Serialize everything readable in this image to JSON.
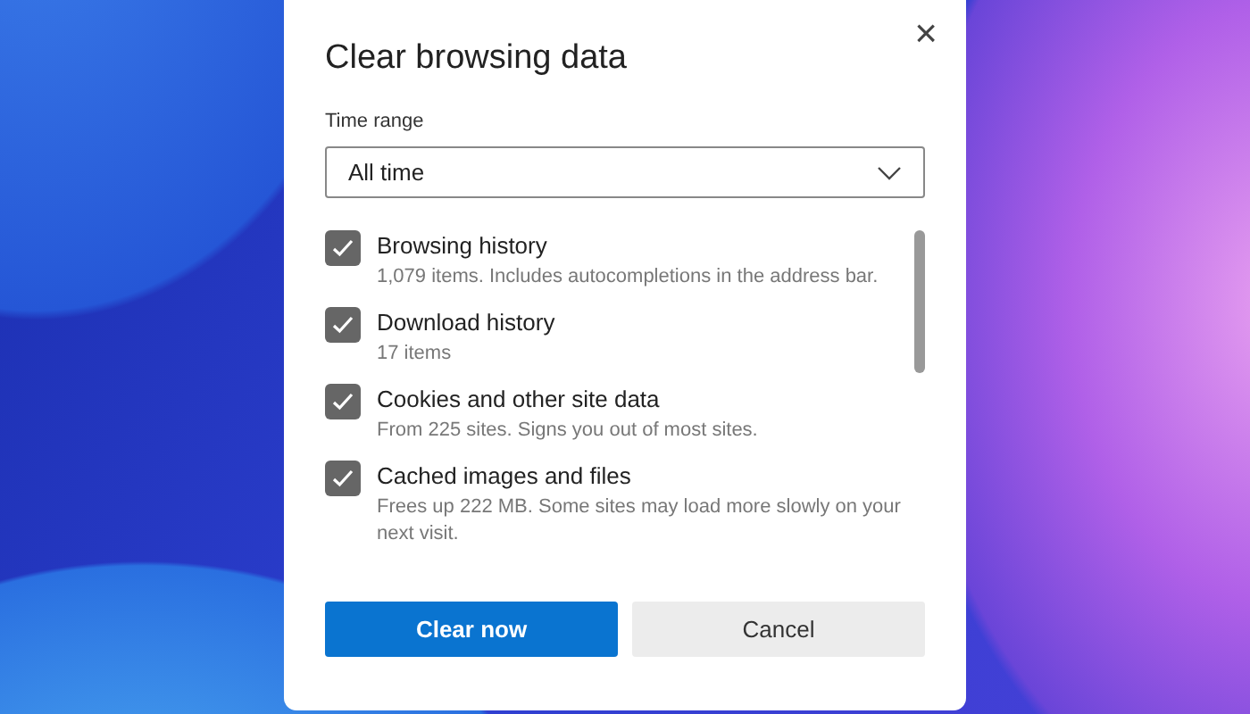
{
  "dialog": {
    "title": "Clear browsing data",
    "close_label": "×",
    "time_range": {
      "label": "Time range",
      "value": "All time"
    },
    "items": [
      {
        "label": "Browsing history",
        "description": "1,079 items. Includes autocompletions in the address bar.",
        "checked": true
      },
      {
        "label": "Download history",
        "description": "17 items",
        "checked": true
      },
      {
        "label": "Cookies and other site data",
        "description": "From 225 sites. Signs you out of most sites.",
        "checked": true
      },
      {
        "label": "Cached images and files",
        "description": "Frees up 222 MB. Some sites may load more slowly on your next visit.",
        "checked": true
      }
    ],
    "buttons": [
      {
        "label": "Clear now",
        "kind": "primary"
      },
      {
        "label": "Cancel",
        "kind": "secondary"
      }
    ]
  }
}
